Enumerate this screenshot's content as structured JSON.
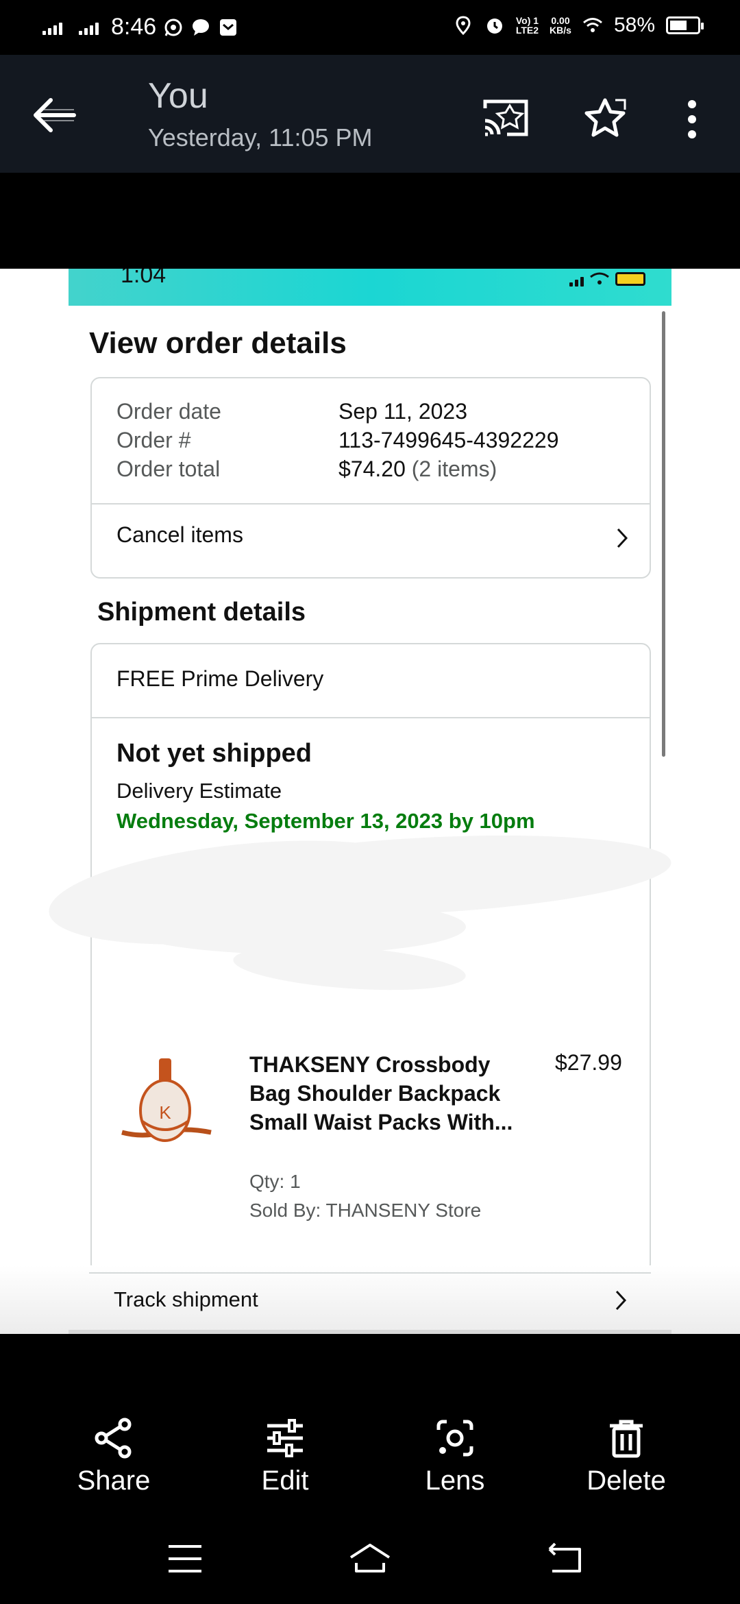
{
  "status_bar": {
    "time": "8:46",
    "net_type": "LTE2",
    "volte": "Vo) 1",
    "speed_value": "0.00",
    "speed_unit": "KB/s",
    "battery": "58%"
  },
  "app_bar": {
    "title": "You",
    "subtitle": "Yesterday, 11:05 PM"
  },
  "screenshot": {
    "inner_status_time": "1:04",
    "page_title": "View order details",
    "order": {
      "rows": [
        {
          "label": "Order date",
          "value": "Sep 11, 2023",
          "extra": ""
        },
        {
          "label": "Order #",
          "value": "113-7499645-4392229",
          "extra": ""
        },
        {
          "label": "Order total",
          "value": "$74.20",
          "extra": "(2 items)"
        }
      ],
      "cancel_label": "Cancel items"
    },
    "shipment": {
      "heading": "Shipment details",
      "delivery_type": "FREE Prime Delivery",
      "status": "Not yet shipped",
      "estimate_label": "Delivery Estimate",
      "estimate_date": "Wednesday, September 13, 2023 by 10pm"
    },
    "product": {
      "name": "THAKSENY Crossbody Bag Shoulder Backpack Small Waist Packs With...",
      "price": "$27.99",
      "qty": "Qty: 1",
      "sold_by": "Sold By: THANSENY Store",
      "image_letter": "K"
    },
    "track_label": "Track shipment"
  },
  "actions": [
    {
      "label": "Share",
      "icon": "share-icon"
    },
    {
      "label": "Edit",
      "icon": "sliders-icon"
    },
    {
      "label": "Lens",
      "icon": "lens-icon"
    },
    {
      "label": "Delete",
      "icon": "trash-icon"
    }
  ],
  "colors": {
    "appbar_bg": "#131820",
    "delivery_green": "#067d0f",
    "inner_status_teal": "#1bd6d3"
  }
}
